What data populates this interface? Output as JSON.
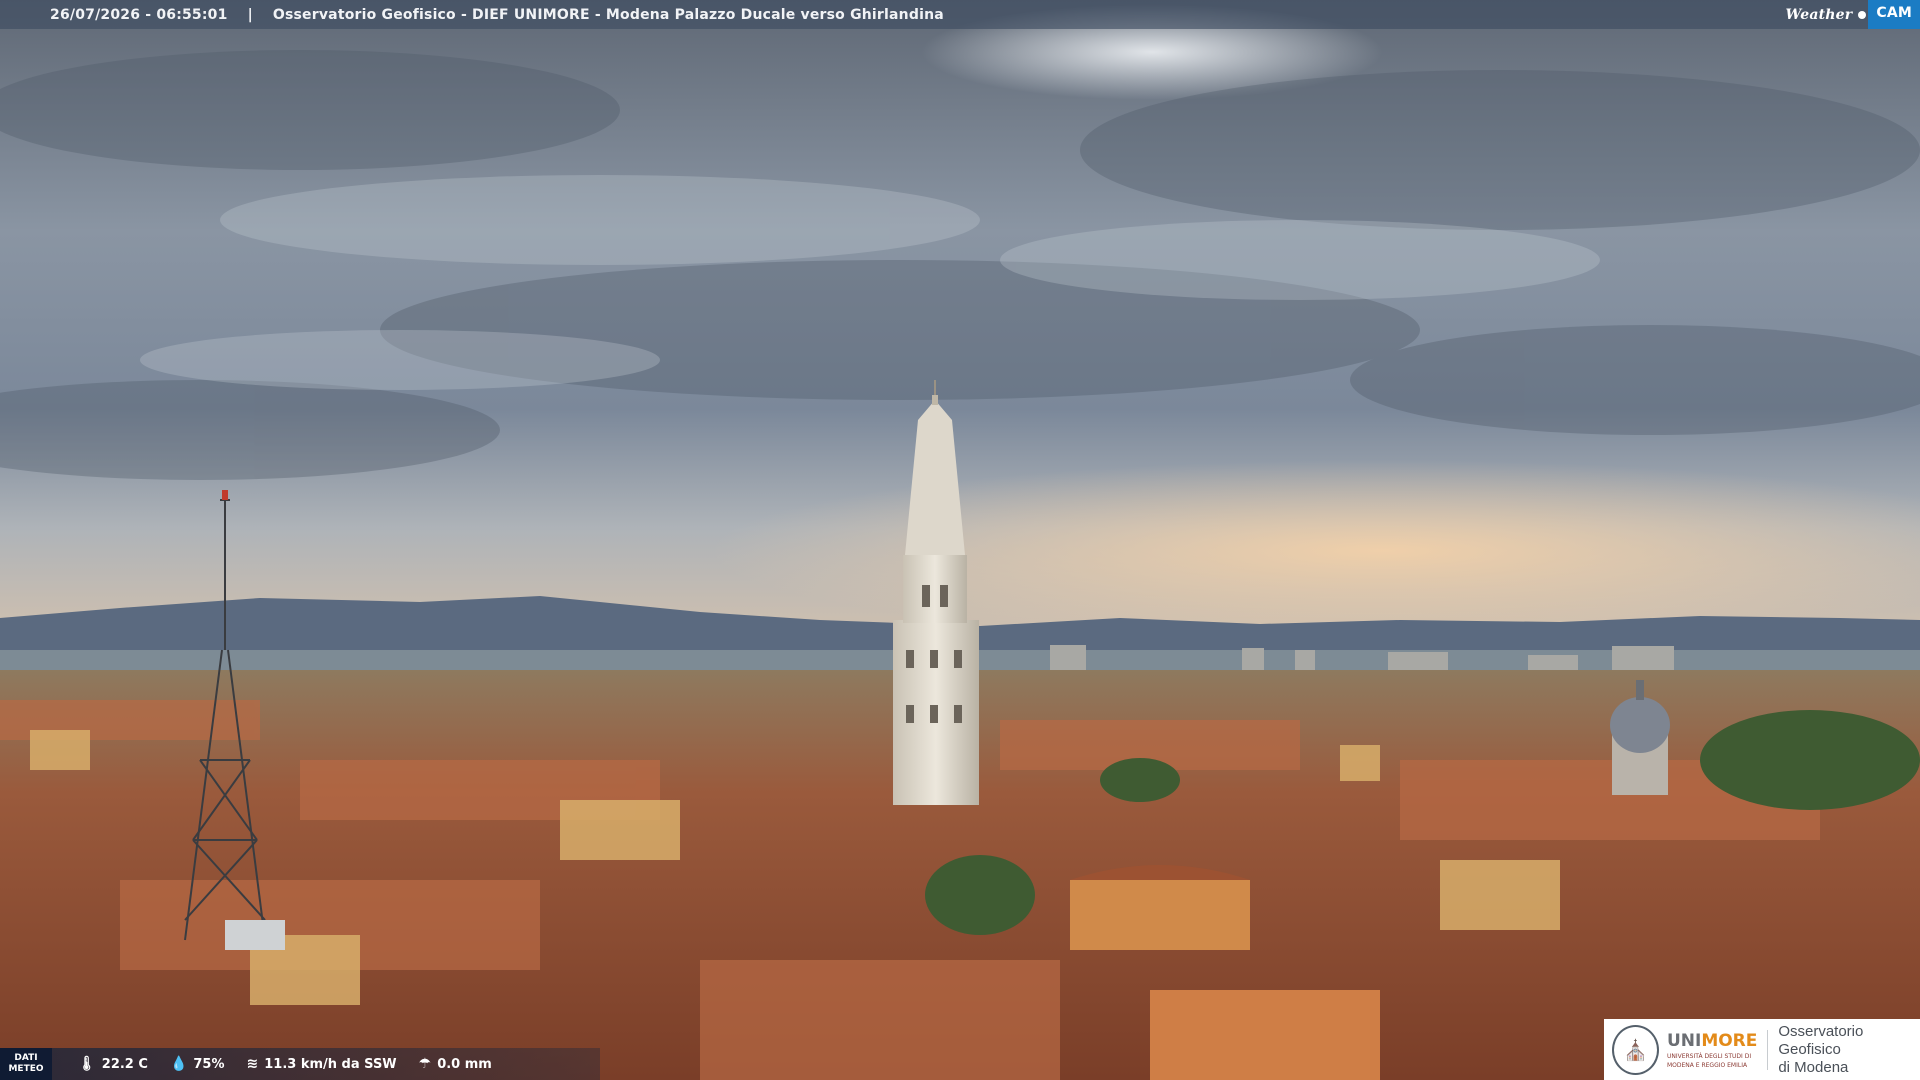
{
  "overlay": {
    "timestamp": "26/07/2026 - 06:55:01",
    "separator": "|",
    "caption": "Osservatorio Geofisico - DIEF UNIMORE - Modena Palazzo Ducale verso Ghirlandina",
    "brand": {
      "weather": "Weather",
      "cam": "CAM"
    }
  },
  "meteo": {
    "label_line1": "DATI",
    "label_line2": "METEO",
    "temperature": "22.2 C",
    "humidity": "75%",
    "wind": "11.3 km/h da SSW",
    "rain": "0.0 mm",
    "icons": [
      "thermometer-icon",
      "humidity-drop-icon",
      "wind-icon",
      "rain-icon"
    ]
  },
  "logo": {
    "name_gray": "UNI",
    "name_orange": "MORE",
    "university_line1": "UNIVERSITÀ DEGLI STUDI DI",
    "university_line2": "MODENA E REGGIO EMILIA",
    "observatory_line1": "Osservatorio Geofisico",
    "observatory_line2": "di Modena"
  },
  "colors": {
    "sky_top": "#6b7480",
    "sky_mid": "#9aa4b1",
    "horizon_glow": "#f2c9a0",
    "mountains": "#5f6f86",
    "roofs": "#a4573a",
    "walls": "#d2a865",
    "tower": "#e6e1d6",
    "unimore_orange": "#e38b1a",
    "weathercam_blue": "#1b7cc4"
  }
}
